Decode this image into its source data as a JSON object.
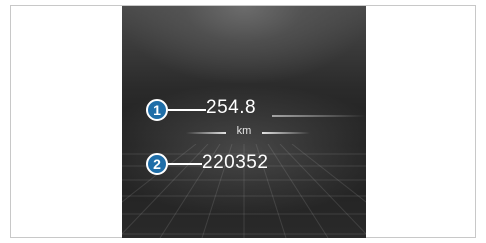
{
  "readouts": [
    {
      "marker": "1",
      "value": "254.8"
    },
    {
      "marker": "2",
      "value": "220352"
    }
  ],
  "unit": "km",
  "colors": {
    "marker_fill": "#1f6ea8",
    "marker_border": "#ffffff",
    "text": "#ffffff",
    "display_background": "#2b2b2b"
  }
}
